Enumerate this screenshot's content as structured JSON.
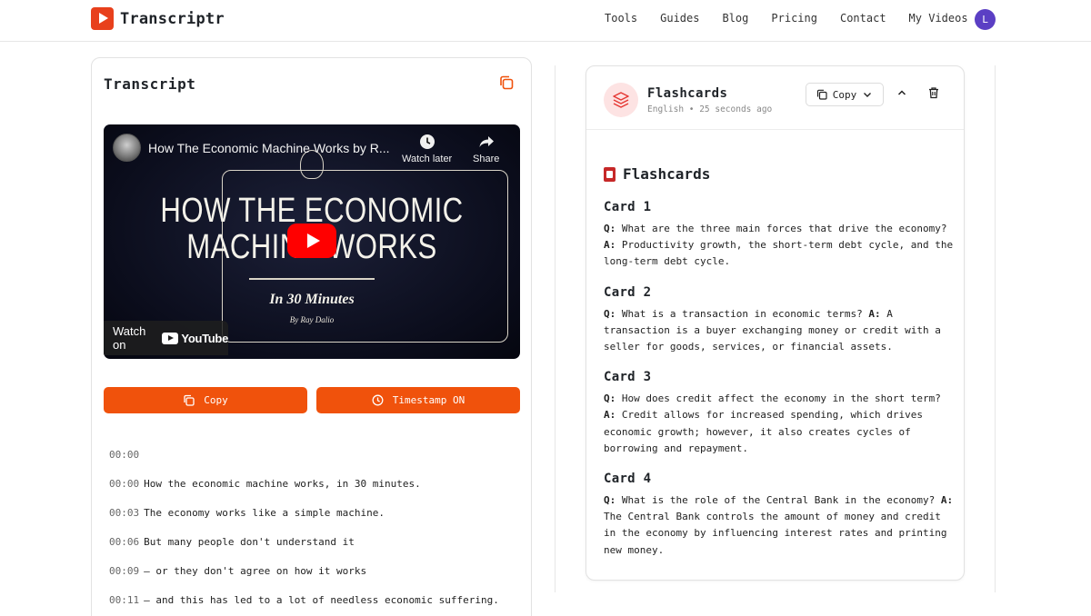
{
  "header": {
    "brand": "Transcriptr",
    "nav": [
      "Tools",
      "Guides",
      "Blog",
      "Pricing",
      "Contact",
      "My Videos"
    ],
    "avatar_initial": "L"
  },
  "transcript_panel": {
    "title": "Transcript",
    "video": {
      "title": "How The Economic Machine Works by R...",
      "watch_later": "Watch later",
      "share": "Share",
      "big_title_line1": "HOW THE ECONOMIC",
      "big_title_line2": "MACHINE WORKS",
      "subtitle": "In 30 Minutes",
      "byline": "By Ray Dalio",
      "watch_on": "Watch on",
      "youtube": "YouTube"
    },
    "copy_label": "Copy",
    "timestamp_label": "Timestamp ON",
    "lines": [
      {
        "ts": "00:00",
        "text": ""
      },
      {
        "ts": "00:00",
        "text": "How the economic machine works, in 30 minutes."
      },
      {
        "ts": "00:03",
        "text": "The economy works like a simple machine."
      },
      {
        "ts": "00:06",
        "text": "But many people don't understand it"
      },
      {
        "ts": "00:09",
        "text": "— or they don't agree on how it works"
      },
      {
        "ts": "00:11",
        "text": "— and this has led to a lot of needless economic suffering."
      }
    ]
  },
  "flashcards_panel": {
    "title": "Flashcards",
    "meta": "English • 25 seconds ago",
    "copy_label": "Copy",
    "heading": "Flashcards",
    "cards": [
      {
        "title": "Card 1",
        "q_label": "Q:",
        "q": "What are the three main forces that drive the economy?",
        "a_label": "A:",
        "a": "Productivity growth, the short-term debt cycle, and the long-term debt cycle."
      },
      {
        "title": "Card 2",
        "q_label": "Q:",
        "q": "What is a transaction in economic terms?",
        "a_label": "A:",
        "a": "A transaction is a buyer exchanging money or credit with a seller for goods, services, or financial assets."
      },
      {
        "title": "Card 3",
        "q_label": "Q:",
        "q": "How does credit affect the economy in the short term?",
        "a_label": "A:",
        "a": "Credit allows for increased spending, which drives economic growth; however, it also creates cycles of borrowing and repayment."
      },
      {
        "title": "Card 4",
        "q_label": "Q:",
        "q": "What is the role of the Central Bank in the economy?",
        "a_label": "A:",
        "a": "The Central Bank controls the amount of money and credit in the economy by influencing interest rates and printing new money."
      }
    ]
  },
  "colors": {
    "accent": "#f0520c",
    "brand_red": "#e8401c",
    "avatar": "#5b3fc4"
  }
}
